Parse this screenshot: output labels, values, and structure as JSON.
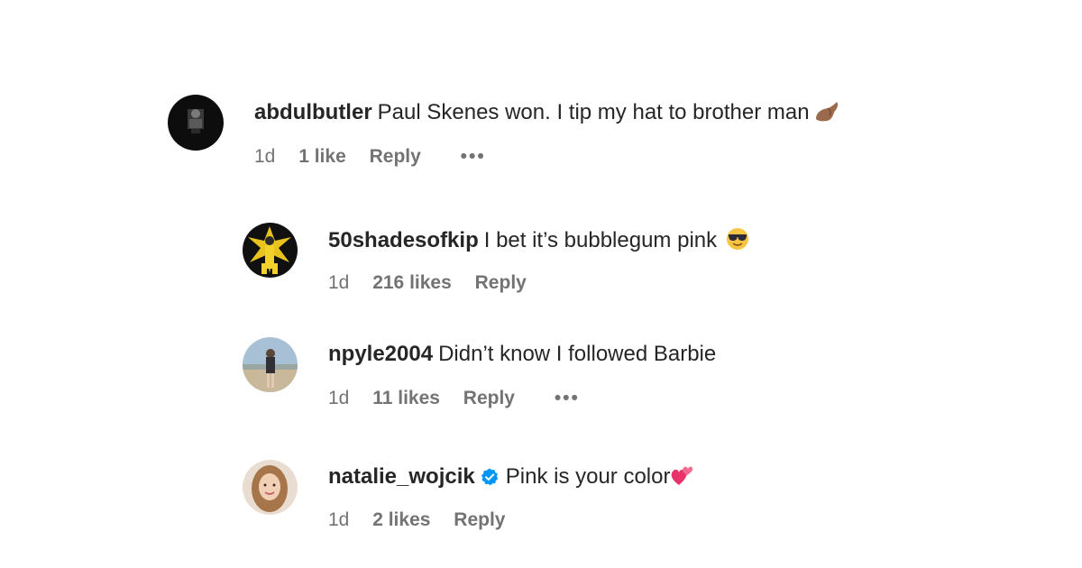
{
  "comments": [
    {
      "username": "abdulbutler",
      "text": "Paul Skenes won. I tip my hat to brother man",
      "emoji": "finger-pointing-emoji",
      "age": "1d",
      "likes": "1 like",
      "reply": "Reply",
      "more": "•••"
    },
    {
      "username": "50shadesofkip",
      "text": "I bet it’s bubblegum pink",
      "emoji": "sunglasses-emoji",
      "age": "1d",
      "likes": "216 likes",
      "reply": "Reply"
    },
    {
      "username": "npyle2004",
      "text": "Didn’t know I followed Barbie",
      "age": "1d",
      "likes": "11 likes",
      "reply": "Reply",
      "more": "•••"
    },
    {
      "username": "natalie_wojcik",
      "verified": true,
      "text": "Pink is your color",
      "emoji": "two-hearts-emoji",
      "age": "1d",
      "likes": "2 likes",
      "reply": "Reply"
    }
  ],
  "colors": {
    "text": "#262626",
    "meta": "#737373",
    "verified": "#0095f6"
  }
}
